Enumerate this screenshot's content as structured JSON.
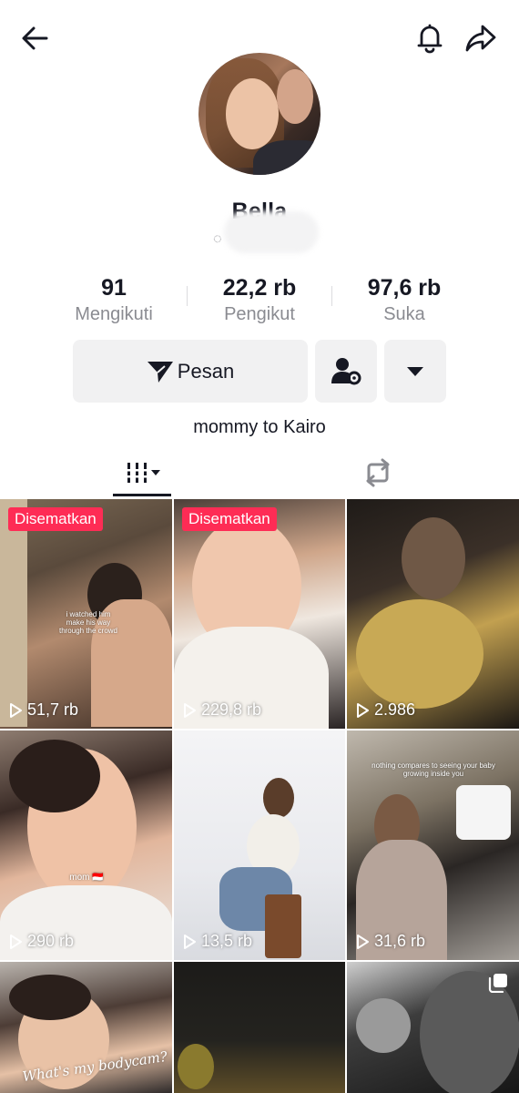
{
  "profile": {
    "name": "Bella",
    "handle": "",
    "bio": "mommy to Kairo"
  },
  "stats": {
    "following": {
      "value": "91",
      "label": "Mengikuti"
    },
    "followers": {
      "value": "22,2 rb",
      "label": "Pengikut"
    },
    "likes": {
      "value": "97,6 rb",
      "label": "Suka"
    }
  },
  "actions": {
    "message_label": "Pesan"
  },
  "grid": {
    "pinned_label": "Disematkan",
    "videos": [
      {
        "views": "51,7 rb",
        "pinned": true,
        "caption": "i watched him make his way through the crowd"
      },
      {
        "views": "229,8 rb",
        "pinned": true
      },
      {
        "views": "2.986",
        "pinned": false
      },
      {
        "views": "290 rb",
        "pinned": false,
        "caption": "mom 🇮🇩"
      },
      {
        "views": "13,5 rb",
        "pinned": false
      },
      {
        "views": "31,6 rb",
        "pinned": false,
        "caption": "nothing compares to seeing your baby growing inside you"
      },
      {
        "views": "",
        "pinned": false,
        "caption": "What's my bodycam?"
      },
      {
        "views": "",
        "pinned": false
      },
      {
        "views": "",
        "pinned": false,
        "multi": true
      }
    ]
  },
  "icons": {
    "back": "back-arrow-icon",
    "bell": "bell-icon",
    "share": "share-icon",
    "send": "send-icon",
    "add_user": "add-friend-settings-icon",
    "dropdown": "caret-down-icon",
    "videos_tab": "grid-icon",
    "repost_tab": "repost-icon",
    "play": "play-icon",
    "multi": "photo-carousel-icon"
  },
  "colors": {
    "accent_pinned": "#fe2c55",
    "text": "#161823",
    "muted": "#8a8b91",
    "button_bg": "#f1f1f2"
  }
}
